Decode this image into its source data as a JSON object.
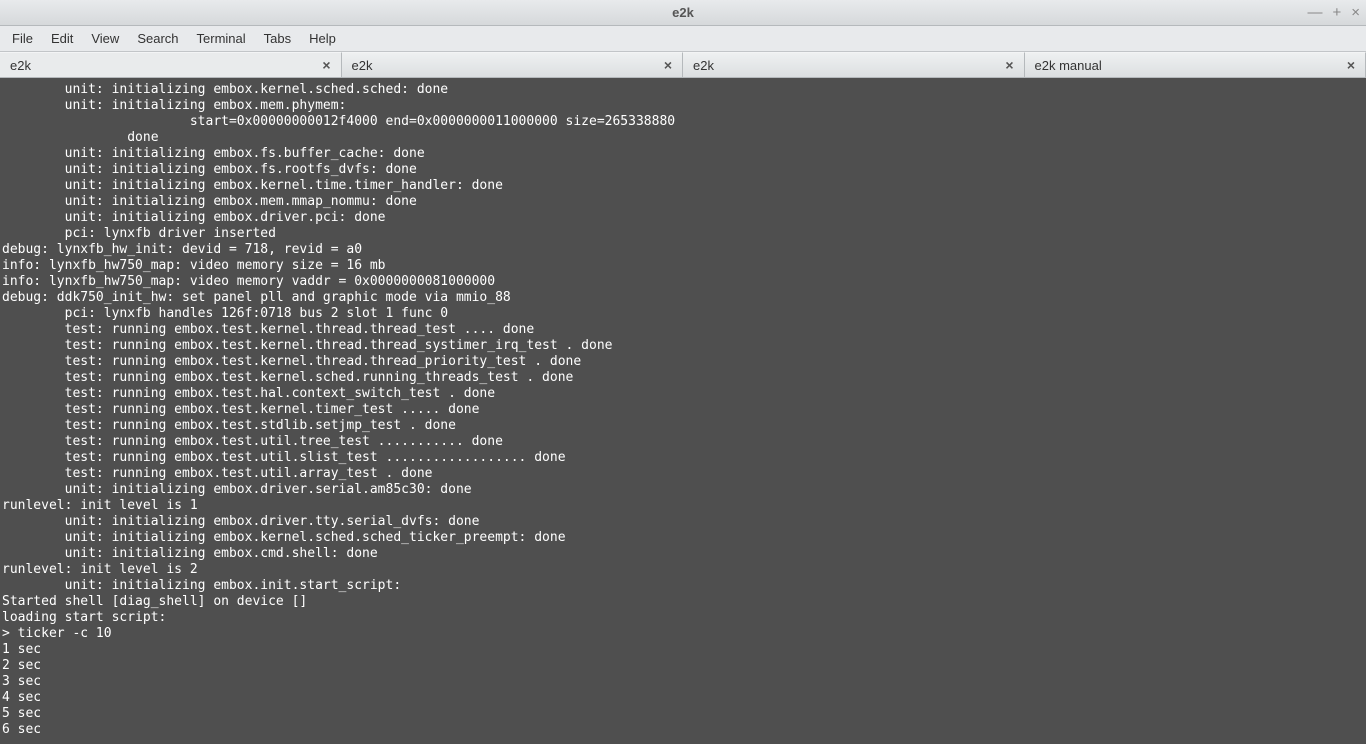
{
  "window": {
    "title": "e2k",
    "buttons": {
      "min": "—",
      "max": "+",
      "close": "×"
    }
  },
  "menu": {
    "items": [
      "File",
      "Edit",
      "View",
      "Search",
      "Terminal",
      "Tabs",
      "Help"
    ]
  },
  "tabs": [
    {
      "label": "e2k",
      "active": true
    },
    {
      "label": "e2k",
      "active": false
    },
    {
      "label": "e2k",
      "active": false
    },
    {
      "label": "e2k manual",
      "active": false
    }
  ],
  "terminal": {
    "lines": [
      "        unit: initializing embox.kernel.sched.sched: done",
      "        unit: initializing embox.mem.phymem:",
      "                        start=0x00000000012f4000 end=0x0000000011000000 size=265338880",
      "                done",
      "        unit: initializing embox.fs.buffer_cache: done",
      "        unit: initializing embox.fs.rootfs_dvfs: done",
      "        unit: initializing embox.kernel.time.timer_handler: done",
      "        unit: initializing embox.mem.mmap_nommu: done",
      "        unit: initializing embox.driver.pci: done",
      "        pci: lynxfb driver inserted",
      "debug: lynxfb_hw_init: devid = 718, revid = a0",
      "info: lynxfb_hw750_map: video memory size = 16 mb",
      "info: lynxfb_hw750_map: video memory vaddr = 0x0000000081000000",
      "debug: ddk750_init_hw: set panel pll and graphic mode via mmio_88",
      "        pci: lynxfb handles 126f:0718 bus 2 slot 1 func 0",
      "        test: running embox.test.kernel.thread.thread_test .... done",
      "        test: running embox.test.kernel.thread.thread_systimer_irq_test . done",
      "        test: running embox.test.kernel.thread.thread_priority_test . done",
      "        test: running embox.test.kernel.sched.running_threads_test . done",
      "        test: running embox.test.hal.context_switch_test . done",
      "        test: running embox.test.kernel.timer_test ..... done",
      "        test: running embox.test.stdlib.setjmp_test . done",
      "        test: running embox.test.util.tree_test ........... done",
      "        test: running embox.test.util.slist_test .................. done",
      "        test: running embox.test.util.array_test . done",
      "        unit: initializing embox.driver.serial.am85c30: done",
      "runlevel: init level is 1",
      "        unit: initializing embox.driver.tty.serial_dvfs: done",
      "        unit: initializing embox.kernel.sched.sched_ticker_preempt: done",
      "        unit: initializing embox.cmd.shell: done",
      "runlevel: init level is 2",
      "        unit: initializing embox.init.start_script:",
      "Started shell [diag_shell] on device []",
      "loading start script:",
      "> ticker -c 10",
      "1 sec",
      "2 sec",
      "3 sec",
      "4 sec",
      "5 sec",
      "6 sec"
    ]
  }
}
